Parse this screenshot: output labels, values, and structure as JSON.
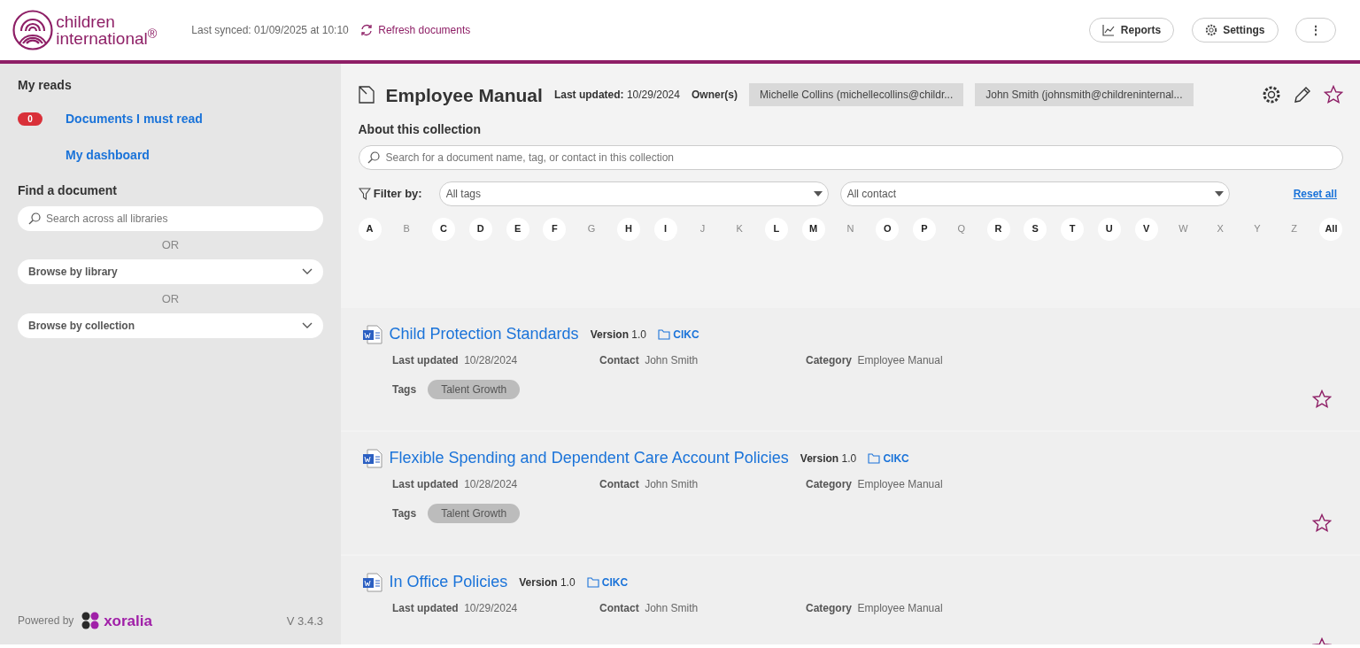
{
  "header": {
    "brand_lines": [
      "children",
      "international$^{®}$"
    ],
    "sync_text": "Last synced: 01/09/2025 at 10:10",
    "refresh_link": "Refresh documents",
    "buttons": [
      {
        "kind": "reports",
        "label": "Reports"
      },
      {
        "kind": "settings",
        "label": "Settings"
      },
      {
        "kind": "more",
        "label": "⋮"
      }
    ]
  },
  "sidebar": {
    "my_reads_title": "My reads",
    "links": [
      {
        "label": "Documents I must read",
        "badge": "0"
      },
      {
        "label": "My dashboard"
      }
    ],
    "find_title": "Find a document",
    "search_placeholder": "Search across all libraries",
    "separators": [
      "OR",
      "OR"
    ],
    "dropdowns": [
      "Browse by library",
      "Browse by collection"
    ],
    "powered_by": "Powered by",
    "vendor": "xoralia",
    "version": "V 3.4.3"
  },
  "collection": {
    "title": "Employee Manual",
    "updated_label": "Last updated:",
    "updated_value": "10/29/2024",
    "owners_label": "Owner(s)",
    "owners": [
      "Michelle Collins (michellecollins@childr...",
      "John Smith (johnsmith@childreninternal..."
    ],
    "favorite": false,
    "about": "About this collection",
    "search_placeholder": "Search for a document name, tag, or contact in this collection",
    "filter_label": "Filter by:",
    "filters": [
      "All tags",
      "All contact"
    ],
    "reset": "Reset all",
    "letters": [
      {
        "label": "A",
        "disabled": false
      },
      {
        "label": "B",
        "disabled": true
      },
      {
        "label": "C",
        "disabled": false
      },
      {
        "label": "D",
        "disabled": false
      },
      {
        "label": "E",
        "disabled": false
      },
      {
        "label": "F",
        "disabled": false
      },
      {
        "label": "G",
        "disabled": true
      },
      {
        "label": "H",
        "disabled": false
      },
      {
        "label": "I",
        "disabled": false
      },
      {
        "label": "J",
        "disabled": true
      },
      {
        "label": "K",
        "disabled": true
      },
      {
        "label": "L",
        "disabled": false
      },
      {
        "label": "M",
        "disabled": false
      },
      {
        "label": "N",
        "disabled": true
      },
      {
        "label": "O",
        "disabled": false
      },
      {
        "label": "P",
        "disabled": false
      },
      {
        "label": "Q",
        "disabled": true
      },
      {
        "label": "R",
        "disabled": false
      },
      {
        "label": "S",
        "disabled": false
      },
      {
        "label": "T",
        "disabled": false
      },
      {
        "label": "U",
        "disabled": false
      },
      {
        "label": "V",
        "disabled": false
      },
      {
        "label": "W",
        "disabled": true
      },
      {
        "label": "X",
        "disabled": true
      },
      {
        "label": "Y",
        "disabled": true
      },
      {
        "label": "Z",
        "disabled": true
      },
      {
        "label": "All",
        "disabled": false
      }
    ]
  },
  "documents": [
    {
      "title": "Child Protection Standards",
      "version_label": "Version",
      "version": "1.0",
      "library": "CIKC",
      "fields": [
        {
          "label": "Last updated",
          "value": "10/28/2024"
        },
        {
          "label": "Contact",
          "value": "John Smith"
        },
        {
          "label": "Category",
          "value": "Employee Manual"
        }
      ],
      "tags_label": "Tags",
      "tags": [
        "Talent Growth"
      ],
      "favorite": false
    },
    {
      "title": "Flexible Spending and Dependent Care Account Policies",
      "version_label": "Version",
      "version": "1.0",
      "library": "CIKC",
      "fields": [
        {
          "label": "Last updated",
          "value": "10/28/2024"
        },
        {
          "label": "Contact",
          "value": "John Smith"
        },
        {
          "label": "Category",
          "value": "Employee Manual"
        }
      ],
      "tags_label": "Tags",
      "tags": [
        "Talent Growth"
      ],
      "favorite": false
    },
    {
      "title": "In Office Policies",
      "version_label": "Version",
      "version": "1.0",
      "library": "CIKC",
      "fields": [
        {
          "label": "Last updated",
          "value": "10/29/2024"
        },
        {
          "label": "Contact",
          "value": "John Smith"
        },
        {
          "label": "Category",
          "value": "Employee Manual"
        }
      ],
      "favorite": false
    }
  ]
}
